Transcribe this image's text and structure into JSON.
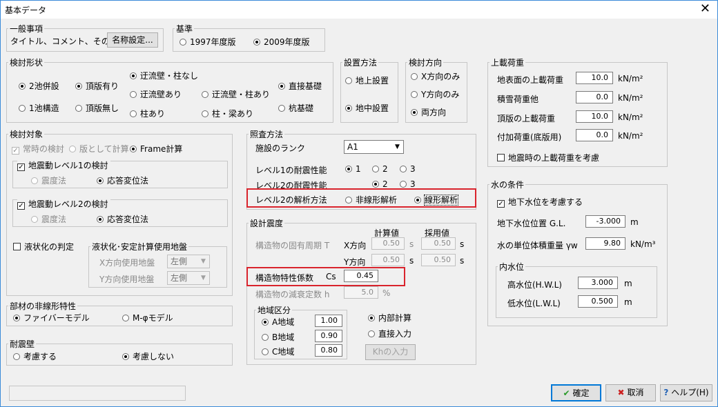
{
  "window": {
    "title": "基本データ"
  },
  "general": {
    "legend": "一般事項",
    "label": "タイトル、コメント、その他",
    "name_button": "名称設定..."
  },
  "standard": {
    "legend": "基準",
    "opt1": "1997年度版",
    "opt2": "2009年度版",
    "selected": "2009年度版"
  },
  "form": {
    "legend": "検討形状",
    "col1": [
      "2池併設",
      "1池構造"
    ],
    "col2": [
      "頂版有り",
      "頂版無し"
    ],
    "col3": [
      "迂流壁・柱なし",
      "迂流壁あり",
      "柱あり"
    ],
    "col4": [
      "迂流壁・柱あり",
      "柱・梁あり"
    ],
    "col5": [
      "直接基礎",
      "杭基礎"
    ]
  },
  "install": {
    "legend": "設置方法",
    "opt1": "地上設置",
    "opt2": "地中設置"
  },
  "direction": {
    "legend": "検討方向",
    "opt1": "X方向のみ",
    "opt2": "Y方向のみ",
    "opt3": "両方向"
  },
  "target": {
    "legend": "検討対象",
    "normal": "常時の検討",
    "slab": "版として計算",
    "frame": "Frame計算",
    "lv1": "地震動レベル1の検討",
    "lv2": "地震動レベル2の検討",
    "seismic": "震度法",
    "response": "応答変位法",
    "liquefaction": "液状化の判定"
  },
  "liq_ground": {
    "legend": "液状化･安定計算使用地盤",
    "x_label": "X方向使用地盤",
    "y_label": "Y方向使用地盤",
    "x_value": "左側",
    "y_value": "左側"
  },
  "member": {
    "legend": "部材の非線形特性",
    "opt1": "ファイバーモデル",
    "opt2": "M-φモデル"
  },
  "wall": {
    "legend": "耐震壁",
    "opt1": "考慮する",
    "opt2": "考慮しない"
  },
  "check": {
    "legend": "照査方法",
    "rank_label": "施設のランク",
    "rank_value": "A1",
    "lv1_label": "レベル1の耐震性能",
    "lv2_label": "レベル2の耐震性能",
    "n1": "1",
    "n2": "2",
    "n3": "3",
    "method_label": "レベル2の解析方法",
    "nonlinear": "非線形解析",
    "linear": "線形解析"
  },
  "design": {
    "legend": "設計震度",
    "calc_header": "計算値",
    "adopt_header": "採用値",
    "period_label": "構造物の固有周期 T",
    "x_dir": "X方向",
    "y_dir": "Y方向",
    "calc_x": "0.50",
    "calc_y": "0.50",
    "adopt_x": "0.50",
    "adopt_y": "0.50",
    "unit_s": "s",
    "cs_label": "構造物特性係数",
    "cs_sym": "Cs",
    "cs_value": "0.45",
    "damp_label": "構造物の減衰定数 h",
    "damp_value": "5.0",
    "damp_unit": "%"
  },
  "region": {
    "legend": "地域区分",
    "a": "A地域",
    "b": "B地域",
    "c": "C地域",
    "a_val": "1.00",
    "b_val": "0.90",
    "c_val": "0.80",
    "internal": "内部計算",
    "direct": "直接入力",
    "kh_button": "Khの入力"
  },
  "load": {
    "legend": "上載荷重",
    "surface": "地表面の上載荷重",
    "snow": "積雪荷重他",
    "top": "頂版の上載荷重",
    "extra": "付加荷重(底版用)",
    "surface_val": "10.0",
    "snow_val": "0.0",
    "top_val": "10.0",
    "extra_val": "0.0",
    "unit": "kN/m²",
    "quake_check": "地震時の上載荷重を考慮"
  },
  "water": {
    "legend": "水の条件",
    "groundwater_check": "地下水位を考慮する",
    "gl_label": "地下水位位置 G.L.",
    "gl_value": "-3.000",
    "gl_unit": "m",
    "weight_label": "水の単位体積重量 γw",
    "weight_value": "9.80",
    "weight_unit": "kN/m³"
  },
  "inner": {
    "legend": "内水位",
    "hwl": "高水位(H.W.L)",
    "lwl": "低水位(L.W.L)",
    "hwl_val": "3.000",
    "lwl_val": "0.500",
    "unit": "m"
  },
  "buttons": {
    "ok": "確定",
    "cancel": "取消",
    "help": "ヘルプ(H)"
  },
  "colors": {
    "highlight": "#d9232c",
    "ok_icon": "#2a9a2a",
    "cancel_icon": "#cc2020",
    "help_icon": "#1e5fb4"
  }
}
